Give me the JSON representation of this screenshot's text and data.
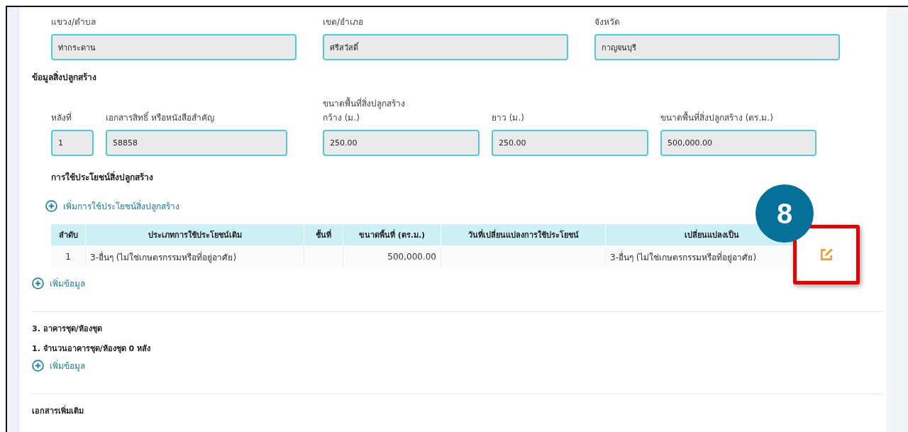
{
  "address_fields": [
    {
      "label": "แขวง/ตำบล",
      "value": "ท่ากระดาน"
    },
    {
      "label": "เขต/อำเภอ",
      "value": "ศรีสวัสดิ์"
    },
    {
      "label": "จังหวัด",
      "value": "กาญจนบุรี"
    }
  ],
  "building_section": {
    "title": "ข้อมูลสิ่งปลูกสร้าง",
    "fields": [
      {
        "label": "หลังที่",
        "value": "1"
      },
      {
        "label": "เอกสารสิทธิ์ หรือหนังสือสำคัญ",
        "value": "58858"
      },
      {
        "group_label": "ขนาดพื้นที่สิ่งปลูกสร้าง",
        "label": "กว้าง (ม.)",
        "value": "250.00"
      },
      {
        "label": "ยาว (ม.)",
        "value": "250.00"
      },
      {
        "label": "ขนาดพื้นที่สิ่งปลูกสร้าง (ตร.ม.)",
        "value": "500,000.00"
      }
    ],
    "usage_title": "การใช้ประโยชน์สิ่งปลูกสร้าง",
    "add_usage_link": "เพิ่มการใช้ประโยชน์สิ่งปลูกสร้าง",
    "table": {
      "columns": [
        "ลำดับ",
        "ประเภทการใช้ประโยชน์เดิม",
        "ชั้นที่",
        "ขนาดพื้นที่ (ตร.ม.)",
        "วันที่เปลี่ยนแปลงการใช้ประโยชน์",
        "เปลี่ยนแปลงเป็น"
      ],
      "rows": [
        {
          "cells": [
            "1",
            "3-อื่นๆ (ไม่ใช่เกษตรกรรมหรือที่อยู่อาศัย)",
            "",
            "500,000.00",
            "",
            "3-อื่นๆ (ไม่ใช่เกษตรกรรมหรือที่อยู่อาศัย)"
          ]
        }
      ]
    },
    "callout_badge": "8",
    "add_link": "เพิ่มข้อมูล"
  },
  "condo_section": {
    "title": "3. อาคารชุด/ห้องชุด",
    "count_line": "1. จำนวนอาคารชุด/ห้องชุด 0 หลัง",
    "add_link": "เพิ่มข้อมูล"
  },
  "documents_section": {
    "title": "เอกสารเพิ่มเติม"
  }
}
